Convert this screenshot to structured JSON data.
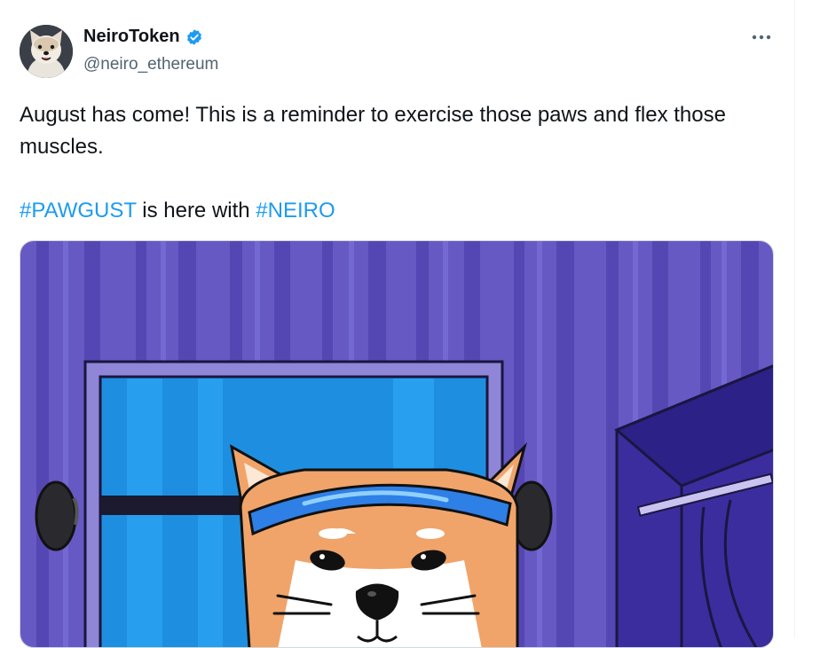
{
  "author": {
    "display_name": "NeiroToken",
    "handle": "@neiro_ethereum",
    "verified": true,
    "avatar_icon": "shiba-dog-avatar"
  },
  "menu": {
    "icon": "more-horizontal-icon"
  },
  "tweet": {
    "line1": "August has come! This is a reminder to exercise those paws and flex those muscles.",
    "line2_hashtag1": "#PAWGUST",
    "line2_middle": " is here with ",
    "line2_hashtag2": "#NEIRO"
  },
  "media": {
    "icon": "shiba-headband-gym-illustration"
  },
  "colors": {
    "hashtag": "#1d9bf0",
    "verified_badge": "#1d9bf0",
    "wall_purple": "#6b5fc4",
    "window_blue": "#1e8fe0"
  }
}
